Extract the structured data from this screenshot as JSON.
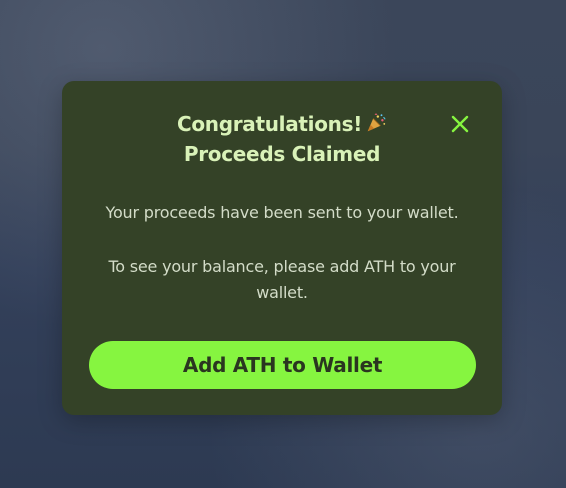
{
  "modal": {
    "title_line1": "Congratulations!",
    "title_line2": "Proceeds Claimed",
    "title_emoji": "party-popper-icon",
    "close_icon": "close-icon",
    "message_sent": "Your proceeds have been sent to your wallet.",
    "message_balance": "To see your balance, please add ATH to your wallet.",
    "cta_label": "Add ATH to Wallet"
  },
  "colors": {
    "modal_bg": "#344227",
    "title": "#d9f2b8",
    "accent": "#86f540",
    "button_text": "#2a3620",
    "body_text": "#d3dcc8"
  }
}
